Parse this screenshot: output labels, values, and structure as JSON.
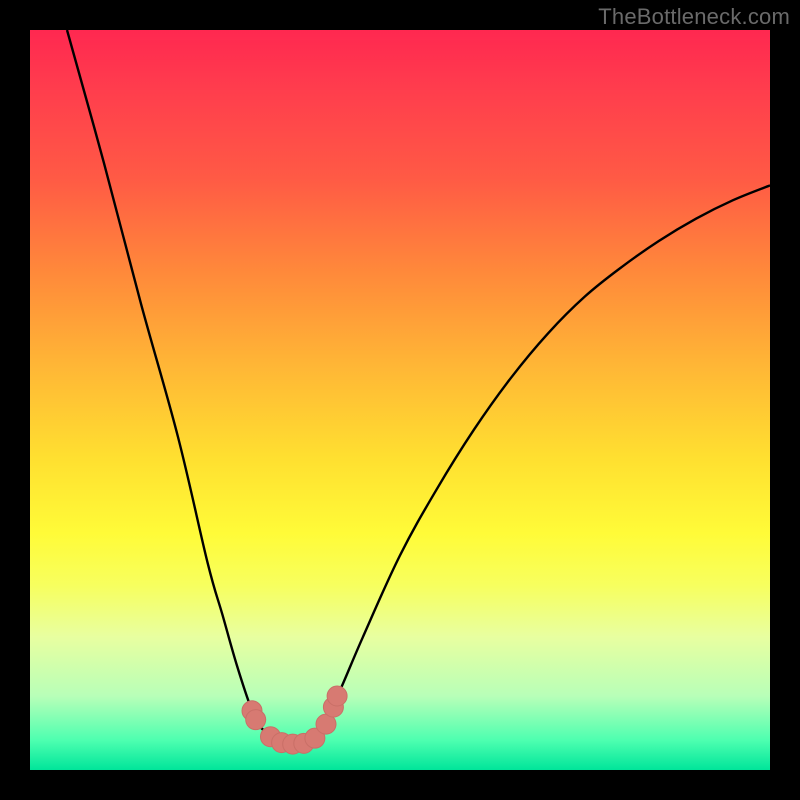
{
  "watermark": "TheBottleneck.com",
  "colors": {
    "frame": "#000000",
    "curve_stroke": "#000000",
    "marker_fill": "#d77a72",
    "marker_stroke": "#c96f67"
  },
  "chart_data": {
    "type": "line",
    "title": "",
    "xlabel": "",
    "ylabel": "",
    "xlim": [
      0,
      100
    ],
    "ylim": [
      0,
      100
    ],
    "grid": false,
    "legend": false,
    "series": [
      {
        "name": "bottleneck-curve",
        "x": [
          5,
          10,
          15,
          20,
          24,
          26,
          28,
          30,
          31,
          32,
          33,
          34,
          35,
          36,
          37,
          38,
          39,
          40,
          42,
          45,
          50,
          55,
          60,
          65,
          70,
          75,
          80,
          85,
          90,
          95,
          100
        ],
        "y": [
          100,
          82,
          63,
          45,
          28,
          21,
          14,
          8,
          6,
          5,
          4.2,
          3.7,
          3.5,
          3.5,
          3.7,
          4.2,
          5.2,
          6.8,
          11,
          18,
          29,
          38,
          46,
          53,
          59,
          64,
          68,
          71.5,
          74.5,
          77,
          79
        ]
      }
    ],
    "markers": [
      {
        "x": 30.0,
        "y": 8.0
      },
      {
        "x": 30.5,
        "y": 6.8
      },
      {
        "x": 32.5,
        "y": 4.5
      },
      {
        "x": 34.0,
        "y": 3.7
      },
      {
        "x": 35.5,
        "y": 3.5
      },
      {
        "x": 37.0,
        "y": 3.6
      },
      {
        "x": 38.5,
        "y": 4.3
      },
      {
        "x": 40.0,
        "y": 6.2
      },
      {
        "x": 41.0,
        "y": 8.5
      },
      {
        "x": 41.5,
        "y": 10.0
      }
    ],
    "marker_radius_px": 10
  }
}
